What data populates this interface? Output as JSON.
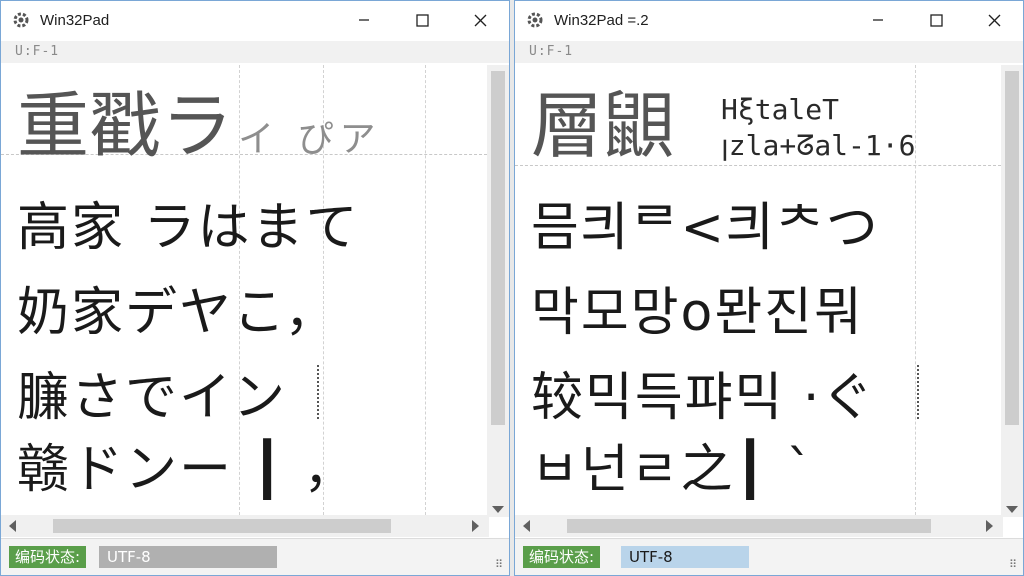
{
  "colors": {
    "status_label_bg": "#5a9e4a",
    "status_value_bg_left": "#b0b0b0",
    "status_value_bg_right": "#b9d4ea",
    "window_border": "#7aa7d6"
  },
  "left": {
    "title": "Win32Pad",
    "icons": {
      "app": "gear-icon",
      "minimize": "minimize-icon",
      "maximize": "maximize-icon",
      "close": "close-icon"
    },
    "encoding_label": "U:F-1",
    "lines": {
      "line1_big": "重戳ラ",
      "line1_small": "イ ぴア",
      "line2": "高家 ラはまて",
      "line3": "奶家デヤこ，",
      "line4": "臁さでイン",
      "line5": "赣ドンー ┃  ，"
    },
    "status": {
      "label": "编码状态:",
      "value": "UTF-8"
    }
  },
  "right": {
    "title": "Win32Pad =.2",
    "icons": {
      "app": "gear-icon",
      "minimize": "minimize-icon",
      "maximize": "maximize-icon",
      "close": "close-icon"
    },
    "encoding_label": "U:F-1",
    "lines": {
      "line1_big": "層鼰",
      "line1_side_top": "HξtaleT",
      "line1_side_bottom": "ꞁzla+ᘔal-1·6",
      "line2": "믐킈ᄅ<킈ᄎつ",
      "line3": "막모망o뫈진뭐",
      "line4": "较믹득퍄믹 ·ぐ",
      "line5": "ㅂ넌ㄹ之┃  ˋ"
    },
    "status": {
      "label": "编码状态:",
      "value": "UTF-8"
    }
  }
}
